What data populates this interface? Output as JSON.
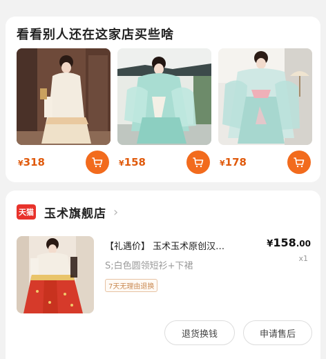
{
  "recommend": {
    "title": "看看别人还在这家店买些啥",
    "products": [
      {
        "currency": "¥",
        "price": "318"
      },
      {
        "currency": "¥",
        "price": "158"
      },
      {
        "currency": "¥",
        "price": "178"
      }
    ]
  },
  "store": {
    "badge": "天猫",
    "name": "玉术旗舰店",
    "chevron": "›"
  },
  "order": {
    "title": "【礼遇价】 玉术玉术原创汉…",
    "currency": "¥",
    "price_int": "158",
    "price_dec": ".00",
    "qty": "x1",
    "spec": "S;白色圆领短衫+下裙",
    "tag": "7天无理由退换"
  },
  "actions": {
    "return_label": "退货换钱",
    "aftersale_label": "申请售后"
  },
  "colors": {
    "accent": "#f26b1d",
    "price": "#e05a0c",
    "tmall": "#e8322b"
  }
}
